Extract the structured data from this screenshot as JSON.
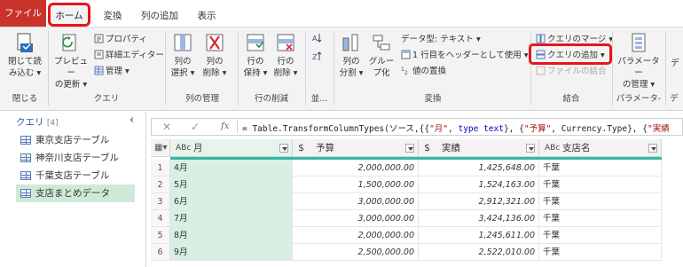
{
  "tabs": {
    "file": "ファイル",
    "home": "ホーム",
    "transform": "変換",
    "add_column": "列の追加",
    "view": "表示"
  },
  "ribbon": {
    "close_load": [
      "閉じて読",
      "み込む ▾"
    ],
    "preview": [
      "プレビュー",
      "の更新 ▾"
    ],
    "properties": "プロパティ",
    "advanced_editor": "詳細エディター",
    "manage": "管理 ▾",
    "choose_cols": [
      "列の",
      "選択 ▾"
    ],
    "remove_cols": [
      "列の",
      "削除 ▾"
    ],
    "keep_rows": [
      "行の",
      "保持 ▾"
    ],
    "remove_rows": [
      "行の",
      "削除 ▾"
    ],
    "split": [
      "列の",
      "分割 ▾"
    ],
    "group": [
      "グルー",
      "プ化"
    ],
    "datatype": "データ型: テキスト ▾",
    "use_header": "1 行目をヘッダーとして使用 ▾",
    "replace": "値の置換",
    "merge": "クエリのマージ ▾",
    "append": "クエリの追加 ▾",
    "combine": "ファイルの結合",
    "params": [
      "パラメーター",
      "の管理 ▾"
    ],
    "data_trunc": "デ",
    "groups": {
      "close": "閉じる",
      "query": "クエリ",
      "manage_cols": "列の管理",
      "reduce_rows": "行の削減",
      "sort": "並...",
      "transform": "変換",
      "combine": "結合",
      "parameters": "パラメータ-",
      "d": "デ"
    }
  },
  "queries": {
    "header": "クエリ",
    "count": "[4]",
    "items": [
      "東京支店テーブル",
      "神奈川支店テーブル",
      "千葉支店テーブル",
      "支店まとめデータ"
    ]
  },
  "formula": {
    "fx": "fx",
    "p1": "= Table.TransformColumnTypes(ソース,{{",
    "s1": "\"月\"",
    "p2": ", ",
    "k1": "type text",
    "p3": "}, {",
    "s2": "\"予算\"",
    "p4": ", Currency.Type}, {",
    "s3": "\"実績"
  },
  "grid": {
    "columns": [
      {
        "type": "ABc",
        "name": "月"
      },
      {
        "type": "$",
        "name": "予算"
      },
      {
        "type": "$",
        "name": "実績"
      },
      {
        "type": "ABc",
        "name": "支店名"
      }
    ],
    "rows": [
      {
        "n": "1",
        "month": "4月",
        "budget": "2,000,000.00",
        "actual": "1,425,648.00",
        "branch": "千葉"
      },
      {
        "n": "2",
        "month": "5月",
        "budget": "1,500,000.00",
        "actual": "1,524,163.00",
        "branch": "千葉"
      },
      {
        "n": "3",
        "month": "6月",
        "budget": "3,000,000.00",
        "actual": "2,912,321.00",
        "branch": "千葉"
      },
      {
        "n": "4",
        "month": "7月",
        "budget": "3,000,000.00",
        "actual": "3,424,136.00",
        "branch": "千葉"
      },
      {
        "n": "5",
        "month": "8月",
        "budget": "2,000,000.00",
        "actual": "1,245,611.00",
        "branch": "千葉"
      },
      {
        "n": "6",
        "month": "9月",
        "budget": "2,500,000.00",
        "actual": "2,522,010.00",
        "branch": "千葉"
      }
    ]
  }
}
